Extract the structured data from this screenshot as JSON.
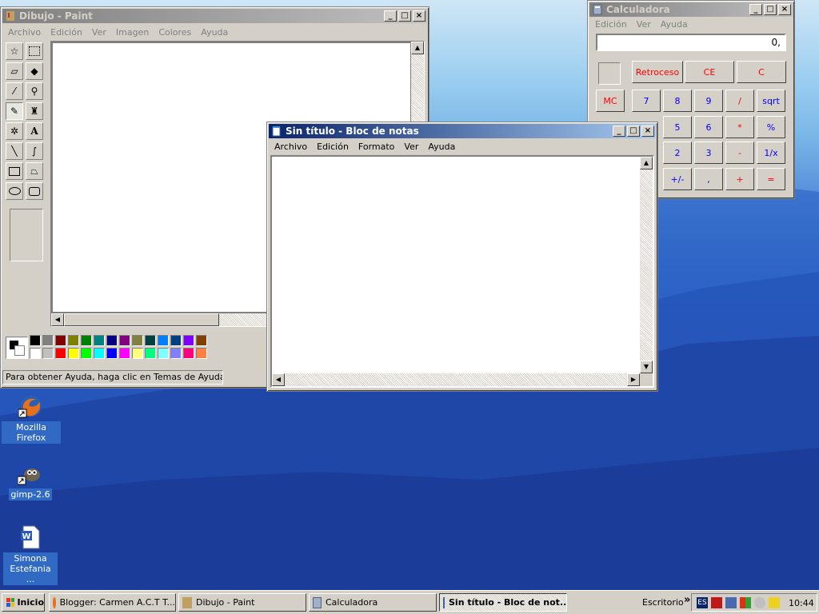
{
  "paint": {
    "title": "Dibujo - Paint",
    "menu": [
      "Archivo",
      "Edición",
      "Ver",
      "Imagen",
      "Colores",
      "Ayuda"
    ],
    "status": "Para obtener Ayuda, haga clic en Temas de Ayuda en el",
    "palette_top": [
      "#000000",
      "#808080",
      "#800000",
      "#808000",
      "#008000",
      "#008080",
      "#000080",
      "#800080",
      "#808040",
      "#004040",
      "#0080ff",
      "#004080",
      "#8000ff",
      "#804000"
    ],
    "palette_bottom": [
      "#ffffff",
      "#c0c0c0",
      "#ff0000",
      "#ffff00",
      "#00ff00",
      "#00ffff",
      "#0000ff",
      "#ff00ff",
      "#ffff80",
      "#00ff80",
      "#80ffff",
      "#8080ff",
      "#ff0080",
      "#ff8040"
    ]
  },
  "calculator": {
    "title": "Calculadora",
    "menu": [
      "Edición",
      "Ver",
      "Ayuda"
    ],
    "display": "0,",
    "buttons": {
      "backspace": "Retroceso",
      "ce": "CE",
      "c": "C",
      "mc": "MC",
      "n7": "7",
      "n8": "8",
      "n9": "9",
      "div": "/",
      "sqrt": "sqrt",
      "n5": "5",
      "n6": "6",
      "mul": "*",
      "pct": "%",
      "n2": "2",
      "n3": "3",
      "sub": "-",
      "inv": "1/x",
      "sign": "+/-",
      "dec": ",",
      "add": "+",
      "eq": "="
    }
  },
  "notepad": {
    "title": "Sin título - Bloc de notas",
    "menu": [
      "Archivo",
      "Edición",
      "Formato",
      "Ver",
      "Ayuda"
    ]
  },
  "desktop_icons": [
    {
      "label": "Mozilla Firefox"
    },
    {
      "label": "gimp-2.6"
    },
    {
      "label": "Simona Estefania ..."
    }
  ],
  "taskbar": {
    "start": "Inicio",
    "items": [
      "Blogger: Carmen A.C.T T...",
      "Dibujo - Paint",
      "Calculadora",
      "Sin título - Bloc de not..."
    ],
    "toolbar_label": "Escritorio",
    "chevron": "»",
    "lang": "ES",
    "clock": "10:44"
  }
}
